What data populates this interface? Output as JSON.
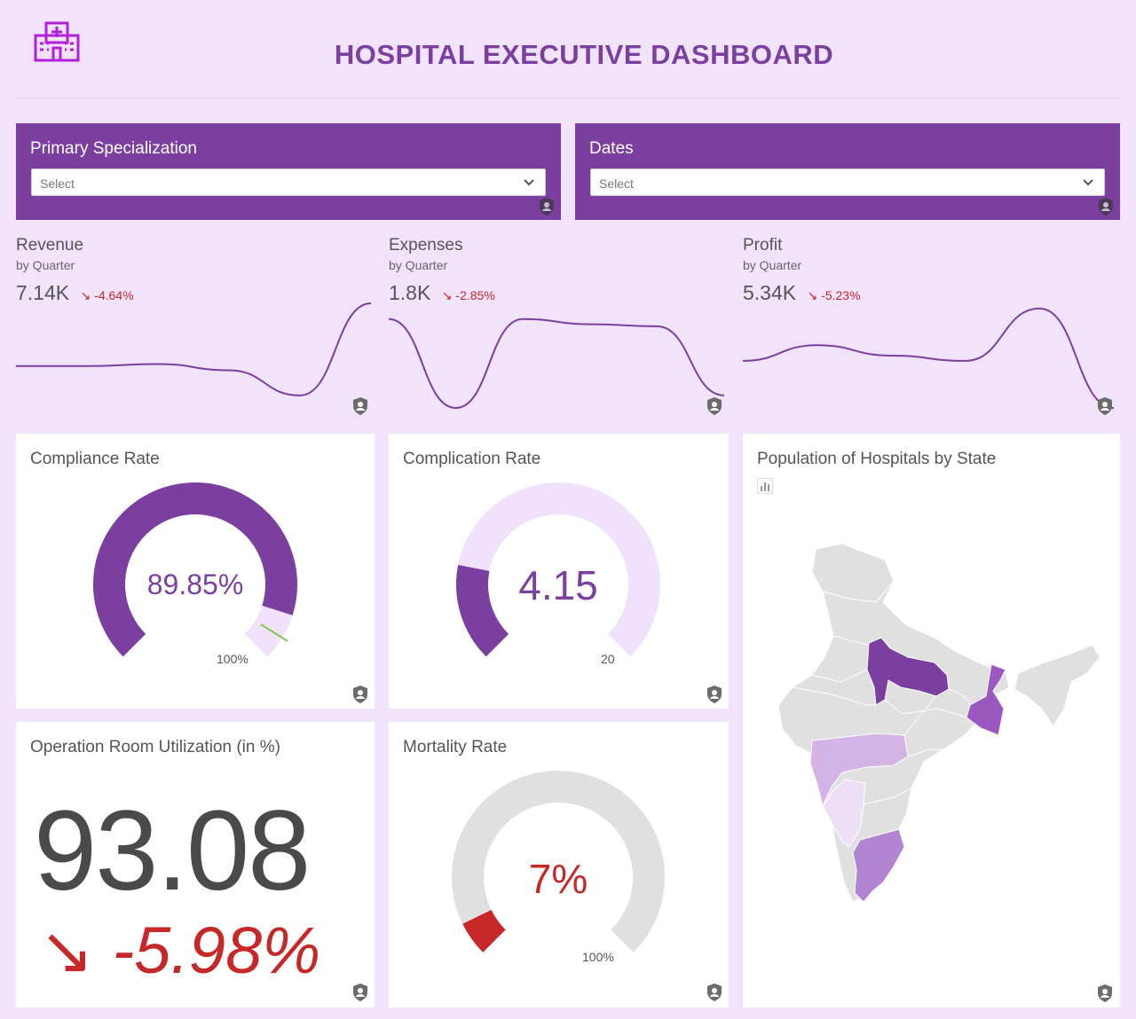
{
  "header": {
    "title": "HOSPITAL EXECUTIVE DASHBOARD",
    "logo_icon": "hospital-icon",
    "accent_color": "#7b3fa0"
  },
  "filters": [
    {
      "label": "Primary Specialization",
      "placeholder": "Select"
    },
    {
      "label": "Dates",
      "placeholder": "Select"
    }
  ],
  "kpis": [
    {
      "title": "Revenue",
      "subtitle": "by Quarter",
      "value": "7.14K",
      "delta": "-4.64%",
      "trend": [
        0.4,
        0.4,
        0.42,
        0.36,
        0.12,
        1.0
      ]
    },
    {
      "title": "Expenses",
      "subtitle": "by Quarter",
      "value": "1.8K",
      "delta": "-2.85%",
      "trend": [
        0.85,
        0.0,
        0.85,
        0.8,
        0.78,
        0.12
      ]
    },
    {
      "title": "Profit",
      "subtitle": "by Quarter",
      "value": "5.34K",
      "delta": "-5.23%",
      "trend": [
        0.45,
        0.6,
        0.5,
        0.45,
        0.95,
        0.0
      ]
    }
  ],
  "compliance": {
    "title": "Compliance Rate",
    "value": "89.85%",
    "max_label": "100%",
    "fraction": 0.8985
  },
  "complication": {
    "title": "Complication Rate",
    "value": "4.15",
    "max_label": "20",
    "fraction": 0.2075
  },
  "operation_room": {
    "title": "Operation Room Utilization (in %)",
    "value": "93.08",
    "delta": "-5.98%"
  },
  "mortality": {
    "title": "Mortality Rate",
    "value": "7%",
    "max_label": "100%",
    "fraction": 0.07
  },
  "map": {
    "title": "Population of Hospitals by State"
  },
  "colors": {
    "background": "#f2e3fc",
    "primary": "#7b3fa0",
    "gauge_track_light": "#f0e2fc",
    "gauge_track_gray": "#e0e0e0",
    "negative": "#c62828",
    "map_base": "#e0e0e0"
  }
}
